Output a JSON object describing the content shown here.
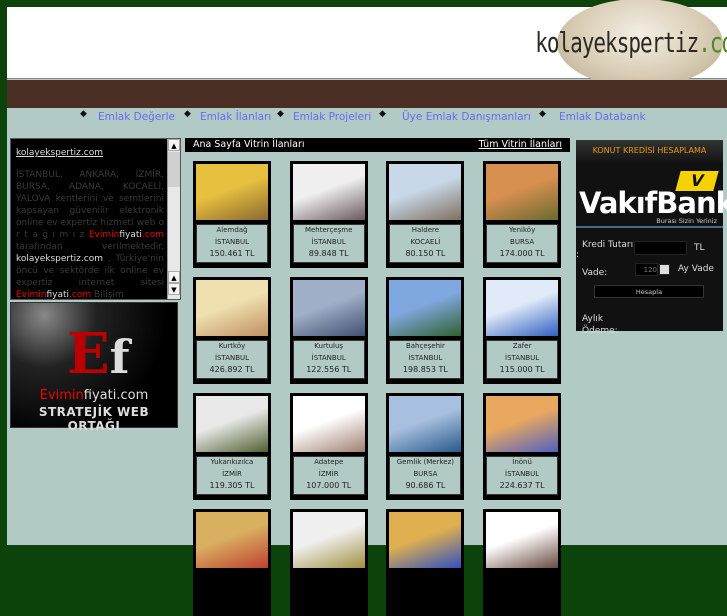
{
  "header": {
    "logo_text": "kolayekspertiz",
    "logo_tld": ".com"
  },
  "nav": [
    "Emlak Değerle",
    "Emlak İlanları",
    "Emlak Projeleri",
    "Üye Emlak Danışmanları",
    "Emlak Databank"
  ],
  "left": {
    "title": "kolayekspertiz.com",
    "p1": "İSTANBUL, ANKARA, İZMİR, BURSA, ADANA, KOCAELİ, YALOVA kentlerini ve semtlerini kapsayan güvenilir elektronik online ev expertiz hizmeti web o r t a ğ ı m ı z",
    "brand_a": "Evimin",
    "brand_b": "fiyati",
    ".com": ".com",
    "p2": "tarafından verilmektedir.",
    "site": "kolayekspertiz.com",
    "p3": ", Türkiye'nin öncü ve sektörde ilk online ev expertiz internet sitesi",
    "p4": "Bilişim"
  },
  "ad": {
    "logo": "Ef",
    "domain_a": "Evimin",
    "domain_b": "fiyati.com",
    "slogan": "STRATEJİK WEB ORTAĞI"
  },
  "center": {
    "title": "Ana Sayfa Vitrin İlanları",
    "all_link": "Tüm Vitrin İlanları"
  },
  "listings": [
    {
      "district": "Alemdağ",
      "city": "İSTANBUL",
      "price": "150.461 TL",
      "c1": "#e8c040",
      "c2": "#8a6a30"
    },
    {
      "district": "Mehterçeşme",
      "city": "İSTANBUL",
      "price": "89.848 TL",
      "c1": "#f0f0f0",
      "c2": "#6a5a60"
    },
    {
      "district": "Haldere",
      "city": "KOCAELİ",
      "price": "80.150 TL",
      "c1": "#c8d8e8",
      "c2": "#807060"
    },
    {
      "district": "Yeniköy",
      "city": "BURSA",
      "price": "174.000 TL",
      "c1": "#d89050",
      "c2": "#6a6a30"
    },
    {
      "district": "Kurtköy",
      "city": "İSTANBUL",
      "price": "426.892 TL",
      "c1": "#f0e0b0",
      "c2": "#c09060"
    },
    {
      "district": "Kurtuluş",
      "city": "İSTANBUL",
      "price": "122.556 TL",
      "c1": "#a0b0c8",
      "c2": "#405070"
    },
    {
      "district": "Bahçeşehir",
      "city": "İSTANBUL",
      "price": "198.853 TL",
      "c1": "#80a8e0",
      "c2": "#306030"
    },
    {
      "district": "Zafer",
      "city": "İSTANBUL",
      "price": "115.000 TL",
      "c1": "#e0eaf8",
      "c2": "#3060c0"
    },
    {
      "district": "Yukarıkızılca",
      "city": "İZMİR",
      "price": "119.305 TL",
      "c1": "#e8e8e8",
      "c2": "#506030"
    },
    {
      "district": "Adatepe",
      "city": "İZMİR",
      "price": "107.000 TL",
      "c1": "#ffffff",
      "c2": "#a08070"
    },
    {
      "district": "Gemlik (Merkez)",
      "city": "BURSA",
      "price": "90.686 TL",
      "c1": "#a8c0e0",
      "c2": "#2a5a8a"
    },
    {
      "district": "İnönü",
      "city": "İSTANBUL",
      "price": "224.637 TL",
      "c1": "#e8a860",
      "c2": "#5060c0"
    },
    {
      "c1": "#d8b060",
      "c2": "#c04030"
    },
    {
      "c1": "#f0f0f0",
      "c2": "#a09040"
    },
    {
      "c1": "#e0b050",
      "c2": "#3050c0"
    },
    {
      "c1": "#ffffff",
      "c2": "#6a4a40"
    }
  ],
  "credit": {
    "title": "KONUT KREDİSİ HESAPLAMA",
    "bank_mark": "V",
    "bank": "VakıfBank",
    "slogan": "Burası Sizin Yeriniz",
    "amount_label": "Kredi Tutarı",
    "colon": ":",
    "currency": "TL",
    "term_label": "Vade:",
    "term_value": "120",
    "term_unit": "Ay Vade",
    "button": "Hesapla",
    "result_label_1": "Aylık",
    "result_label_2": "Ödeme:"
  }
}
